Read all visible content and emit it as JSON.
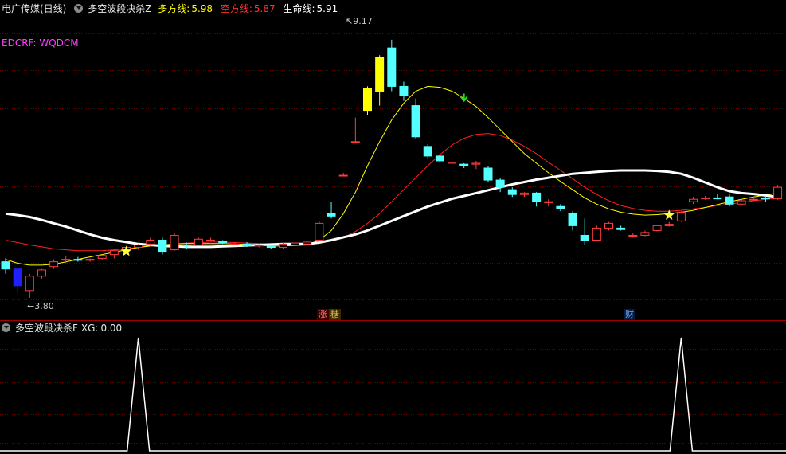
{
  "header": {
    "stock_name": "电广传媒(日线)",
    "indicator_name": "多空波段决杀Z",
    "bull_label": "多方线:",
    "bull_value": "5.98",
    "bear_label": "空方线:",
    "bear_value": "5.87",
    "life_label": "生命线:",
    "life_value": "5.91",
    "edcrf": "EDCRF: WQDCM"
  },
  "price_labels": {
    "high": "9.17",
    "low": "3.80"
  },
  "event_tags": [
    {
      "text": "涨",
      "color": "#ff7070"
    },
    {
      "text": "糖",
      "color": "#e0c060"
    },
    {
      "text": "财",
      "color": "#7fb0ff"
    }
  ],
  "sub_panel": {
    "name": "多空波段决杀F",
    "xg_label": "XG:",
    "xg_value": "0.00"
  },
  "colors": {
    "up": "#ff3b3b",
    "down": "#54ffff",
    "limit_up": "#ffff00",
    "limit_down": "#1f1fff",
    "life": "#ffffff",
    "bull": "#ffff00",
    "bear": "#ff2020",
    "grid": "#6a0000"
  },
  "chart_data": {
    "type": "candlestick",
    "ylim": [
      3.5,
      9.5
    ],
    "x": [
      1,
      2,
      3,
      4,
      5,
      6,
      7,
      8,
      9,
      10,
      11,
      12,
      13,
      14,
      15,
      16,
      17,
      18,
      19,
      20,
      21,
      22,
      23,
      24,
      25,
      26,
      27,
      28,
      29,
      30,
      31,
      32,
      33,
      34,
      35,
      36,
      37,
      38,
      39,
      40,
      41,
      42,
      43,
      44,
      45,
      46,
      47,
      48,
      49,
      50,
      51,
      52,
      53,
      54,
      55,
      56,
      57,
      58,
      59,
      60,
      61,
      62,
      63,
      64,
      65
    ],
    "series": [
      {
        "ohlc": [
          [
            4.55,
            4.62,
            4.3,
            4.4
          ],
          [
            4.4,
            4.4,
            3.9,
            4.05
          ],
          [
            3.95,
            4.3,
            3.8,
            4.25
          ],
          [
            4.25,
            4.4,
            4.2,
            4.38
          ],
          [
            4.45,
            4.6,
            4.4,
            4.55
          ],
          [
            4.6,
            4.68,
            4.52,
            4.6
          ],
          [
            4.6,
            4.65,
            4.55,
            4.58
          ],
          [
            4.58,
            4.62,
            4.55,
            4.6
          ],
          [
            4.62,
            4.7,
            4.58,
            4.68
          ],
          [
            4.7,
            4.8,
            4.62,
            4.78
          ],
          [
            4.8,
            4.88,
            4.72,
            4.85
          ],
          [
            4.85,
            4.92,
            4.8,
            4.9
          ],
          [
            4.92,
            5.05,
            4.88,
            5.0
          ],
          [
            5.0,
            5.05,
            4.7,
            4.75
          ],
          [
            4.8,
            5.15,
            4.78,
            5.1
          ],
          [
            4.9,
            4.95,
            4.82,
            4.88
          ],
          [
            4.9,
            5.05,
            4.88,
            5.02
          ],
          [
            5.0,
            5.05,
            4.98,
            5.0
          ],
          [
            4.98,
            5.0,
            4.92,
            4.95
          ],
          [
            4.92,
            4.95,
            4.9,
            4.92
          ],
          [
            4.92,
            4.96,
            4.86,
            4.88
          ],
          [
            4.88,
            4.92,
            4.85,
            4.9
          ],
          [
            4.88,
            4.9,
            4.82,
            4.85
          ],
          [
            4.85,
            4.95,
            4.82,
            4.92
          ],
          [
            4.9,
            4.96,
            4.88,
            4.94
          ],
          [
            4.92,
            4.98,
            4.9,
            4.96
          ],
          [
            5.0,
            5.4,
            4.98,
            5.35
          ],
          [
            5.55,
            5.8,
            5.45,
            5.5
          ],
          [
            6.35,
            6.4,
            6.35,
            6.35
          ],
          [
            7.05,
            7.55,
            7.05,
            7.05
          ],
          [
            7.7,
            8.2,
            7.6,
            8.15
          ],
          [
            8.1,
            8.85,
            7.8,
            8.8
          ],
          [
            9.0,
            9.17,
            8.1,
            8.2
          ],
          [
            8.2,
            8.3,
            7.9,
            8.0
          ],
          [
            7.8,
            7.95,
            7.1,
            7.15
          ],
          [
            6.95,
            7.0,
            6.7,
            6.75
          ],
          [
            6.75,
            6.8,
            6.6,
            6.65
          ],
          [
            6.6,
            6.7,
            6.45,
            6.62
          ],
          [
            6.58,
            6.6,
            6.5,
            6.55
          ],
          [
            6.58,
            6.65,
            6.48,
            6.6
          ],
          [
            6.5,
            6.55,
            6.2,
            6.25
          ],
          [
            6.25,
            6.3,
            6.0,
            6.1
          ],
          [
            6.05,
            6.1,
            5.9,
            5.95
          ],
          [
            5.95,
            6.0,
            5.9,
            5.98
          ],
          [
            5.98,
            6.0,
            5.7,
            5.8
          ],
          [
            5.78,
            5.85,
            5.7,
            5.8
          ],
          [
            5.7,
            5.75,
            5.6,
            5.65
          ],
          [
            5.55,
            5.6,
            5.2,
            5.3
          ],
          [
            5.1,
            5.45,
            4.9,
            5.0
          ],
          [
            5.0,
            5.3,
            4.98,
            5.25
          ],
          [
            5.25,
            5.38,
            5.2,
            5.35
          ],
          [
            5.25,
            5.3,
            5.2,
            5.22
          ],
          [
            5.1,
            5.15,
            5.05,
            5.1
          ],
          [
            5.1,
            5.2,
            5.08,
            5.16
          ],
          [
            5.2,
            5.32,
            5.18,
            5.3
          ],
          [
            5.3,
            5.38,
            5.28,
            5.33
          ],
          [
            5.4,
            5.6,
            5.38,
            5.58
          ],
          [
            5.8,
            5.9,
            5.75,
            5.85
          ],
          [
            5.86,
            5.92,
            5.84,
            5.88
          ],
          [
            5.88,
            5.95,
            5.85,
            5.86
          ],
          [
            5.9,
            5.95,
            5.7,
            5.75
          ],
          [
            5.75,
            5.85,
            5.72,
            5.82
          ],
          [
            5.85,
            5.9,
            5.82,
            5.85
          ],
          [
            5.88,
            5.92,
            5.8,
            5.86
          ],
          [
            5.86,
            6.15,
            5.84,
            6.1
          ]
        ]
      }
    ],
    "lines": {
      "life": [
        5.55,
        5.52,
        5.48,
        5.42,
        5.35,
        5.28,
        5.2,
        5.12,
        5.05,
        5.0,
        4.96,
        4.92,
        4.9,
        4.88,
        4.87,
        4.86,
        4.86,
        4.86,
        4.87,
        4.88,
        4.89,
        4.9,
        4.91,
        4.92,
        4.92,
        4.92,
        4.95,
        5.0,
        5.06,
        5.12,
        5.2,
        5.3,
        5.4,
        5.5,
        5.6,
        5.7,
        5.78,
        5.86,
        5.92,
        5.98,
        6.04,
        6.1,
        6.16,
        6.21,
        6.26,
        6.3,
        6.34,
        6.38,
        6.4,
        6.42,
        6.44,
        6.45,
        6.45,
        6.45,
        6.44,
        6.42,
        6.38,
        6.3,
        6.2,
        6.1,
        6.02,
        5.98,
        5.96,
        5.93,
        5.9
      ],
      "bull": [
        4.6,
        4.52,
        4.48,
        4.48,
        4.5,
        4.55,
        4.6,
        4.65,
        4.7,
        4.75,
        4.8,
        4.85,
        4.88,
        4.9,
        4.92,
        4.93,
        4.93,
        4.93,
        4.93,
        4.92,
        4.91,
        4.9,
        4.88,
        4.88,
        4.89,
        4.9,
        5.0,
        5.2,
        5.55,
        6.0,
        6.55,
        7.05,
        7.5,
        7.85,
        8.1,
        8.2,
        8.18,
        8.1,
        7.95,
        7.78,
        7.55,
        7.3,
        7.05,
        6.8,
        6.6,
        6.4,
        6.22,
        6.05,
        5.88,
        5.75,
        5.65,
        5.58,
        5.54,
        5.52,
        5.53,
        5.55,
        5.58,
        5.62,
        5.68,
        5.74,
        5.8,
        5.85,
        5.9,
        5.94,
        5.98
      ],
      "bear": [
        5.0,
        4.95,
        4.9,
        4.86,
        4.82,
        4.8,
        4.78,
        4.78,
        4.78,
        4.8,
        4.82,
        4.85,
        4.88,
        4.9,
        4.92,
        4.94,
        4.95,
        4.96,
        4.96,
        4.95,
        4.94,
        4.93,
        4.92,
        4.92,
        4.92,
        4.92,
        4.94,
        4.98,
        5.05,
        5.18,
        5.35,
        5.55,
        5.8,
        6.05,
        6.3,
        6.55,
        6.78,
        6.98,
        7.12,
        7.2,
        7.22,
        7.18,
        7.08,
        6.95,
        6.8,
        6.62,
        6.45,
        6.28,
        6.1,
        5.95,
        5.82,
        5.72,
        5.66,
        5.62,
        5.6,
        5.6,
        5.62,
        5.65,
        5.68,
        5.72,
        5.75,
        5.78,
        5.82,
        5.85,
        5.87
      ]
    },
    "signals": {
      "x": [
        11,
        56
      ],
      "xg_ylim": [
        0,
        1
      ]
    },
    "grid": true
  }
}
